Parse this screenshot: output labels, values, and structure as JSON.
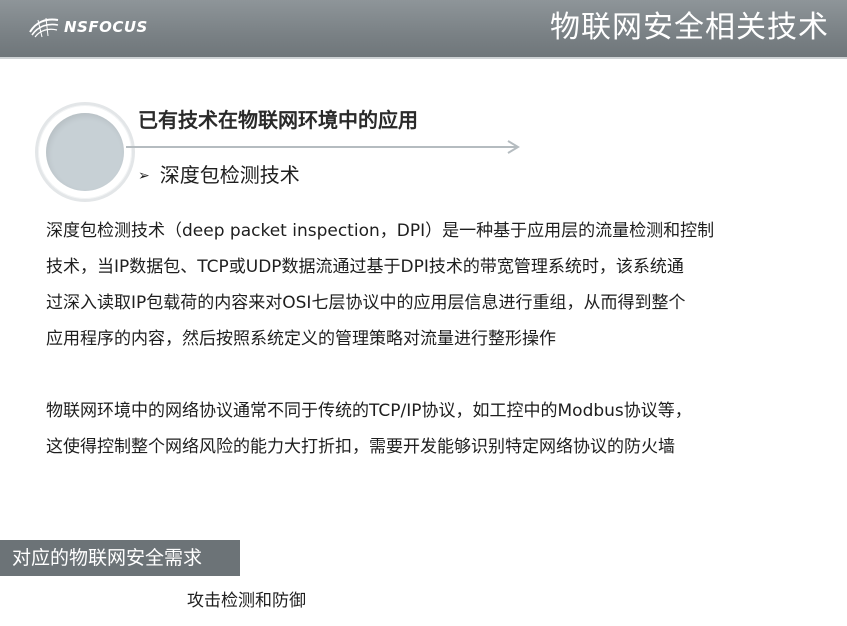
{
  "header": {
    "logo_text": "NSFOCUS",
    "title": "物联网安全相关技术",
    "background": "#7a8185"
  },
  "section": {
    "title": "已有技术在物联网环境中的应用",
    "bullet_icon": "triangle-bullet-icon",
    "subheading": "深度包检测技术"
  },
  "body": {
    "paragraph1_lines": [
      "深度包检测技术（deep packet inspection，DPI）是一种基于应用层的流量检测和控制",
      "技术，当IP数据包、TCP或UDP数据流通过基于DPI技术的带宽管理系统时，该系统通",
      "过深入读取IP包载荷的内容来对OSI七层协议中的应用层信息进行重组，从而得到整个",
      "应用程序的内容，然后按照系统定义的管理策略对流量进行整形操作"
    ],
    "paragraph2_lines": [
      "物联网环境中的网络协议通常不同于传统的TCP/IP协议，如工控中的Modbus协议等，",
      "这使得控制整个网络风险的能力大打折扣，需要开发能够识别特定网络协议的防火墙"
    ]
  },
  "requirements": {
    "label": "对应的物联网安全需求",
    "item": "攻击检测和防御",
    "bar_color": "#6c7377"
  }
}
